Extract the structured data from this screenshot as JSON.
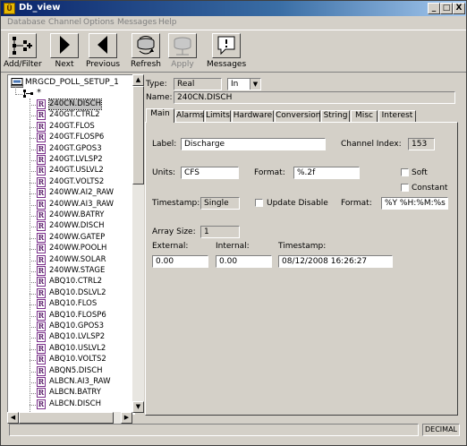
{
  "window": {
    "title": "Db_view",
    "minimize": "_",
    "maximize": "□",
    "close": "X"
  },
  "menu": [
    "Database",
    "Channel",
    "Options",
    "Messages",
    "Help"
  ],
  "toolbar": {
    "add_filter": "Add/Filter",
    "next": "Next",
    "previous": "Previous",
    "refresh": "Refresh",
    "apply": "Apply",
    "messages": "Messages"
  },
  "tree": {
    "root": "MRGCD_POLL_SETUP_1",
    "filter": "*",
    "item_icon": "R",
    "selected_index": 0,
    "items": [
      "240CN.DISCH",
      "240GT.CTRL2",
      "240GT.FLOS",
      "240GT.FLOSP6",
      "240GT.GPOS3",
      "240GT.LVLSP2",
      "240GT.USLVL2",
      "240GT.VOLTS2",
      "240WW.AI2_RAW",
      "240WW.AI3_RAW",
      "240WW.BATRY",
      "240WW.DISCH",
      "240WW.GATEP",
      "240WW.POOLH",
      "240WW.SOLAR",
      "240WW.STAGE",
      "ABQ10.CTRL2",
      "ABQ10.DSLVL2",
      "ABQ10.FLOS",
      "ABQ10.FLOSP6",
      "ABQ10.GPOS3",
      "ABQ10.LVLSP2",
      "ABQ10.USLVL2",
      "ABQ10.VOLTS2",
      "ABQN5.DISCH",
      "ALBCN.AI3_RAW",
      "ALBCN.BATRY",
      "ALBCN.DISCH"
    ]
  },
  "header": {
    "type_label": "Type:",
    "type_value": "Real",
    "direction_value": "In",
    "name_label": "Name:",
    "name_value": "240CN.DISCH"
  },
  "tabs": [
    "Main",
    "Alarms",
    "Limits",
    "Hardware",
    "Conversion",
    "String",
    "Misc",
    "Interest"
  ],
  "main": {
    "label_label": "Label:",
    "label_value": "Discharge",
    "channel_index_label": "Channel Index:",
    "channel_index_value": "153",
    "units_label": "Units:",
    "units_value": "CFS",
    "format_label": "Format:",
    "format_value": "%.2f",
    "soft_label": "Soft",
    "constant_label": "Constant",
    "timestamp_label": "Timestamp:",
    "timestamp_type": "Single",
    "update_disable_label": "Update Disable",
    "ts_format_label": "Format:",
    "ts_format_value": "%Y %H:%M:%s",
    "array_size_label": "Array Size:",
    "array_size_value": "1",
    "external_label": "External:",
    "external_value": "0.00",
    "internal_label": "Internal:",
    "internal_value": "0.00",
    "timestamp2_label": "Timestamp:",
    "timestamp2_value": "08/12/2008 16:26:27"
  },
  "status": {
    "mode": "DECIMAL"
  },
  "colors": {
    "title_bar": "#0a246a",
    "face": "#d4d0c8",
    "item_icon": "#7a2e8a"
  }
}
